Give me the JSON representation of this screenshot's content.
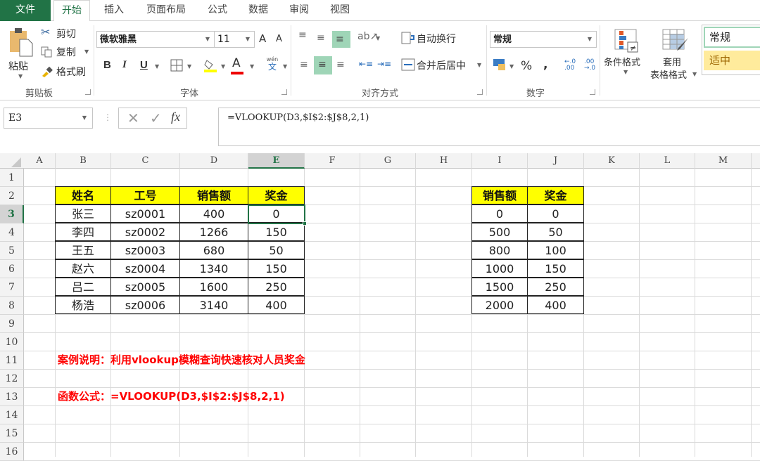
{
  "tabs": [
    {
      "label": "文件",
      "name": "tab-file"
    },
    {
      "label": "开始",
      "name": "tab-home",
      "active": true
    },
    {
      "label": "插入",
      "name": "tab-insert"
    },
    {
      "label": "页面布局",
      "name": "tab-page-layout"
    },
    {
      "label": "公式",
      "name": "tab-formulas"
    },
    {
      "label": "数据",
      "name": "tab-data"
    },
    {
      "label": "审阅",
      "name": "tab-review"
    },
    {
      "label": "视图",
      "name": "tab-view"
    }
  ],
  "ribbon": {
    "clipboard": {
      "label": "剪贴板",
      "paste": "粘贴",
      "cut": "剪切",
      "copy": "复制",
      "format_painter": "格式刷"
    },
    "font": {
      "label": "字体",
      "font_name": "微软雅黑",
      "font_size": "11",
      "bold": "B",
      "italic": "I",
      "underline": "U",
      "grow": "A",
      "shrink": "A",
      "font_color": "A",
      "phonetic_top": "wén",
      "phonetic_bottom": "文"
    },
    "alignment": {
      "label": "对齐方式",
      "wrap_text": "自动换行",
      "merge_center": "合并后居中"
    },
    "number": {
      "label": "数字",
      "format": "常规",
      "percent": "%",
      "comma": ",",
      "inc_decimal": "←.0 .00",
      "dec_decimal": ".00 →.0"
    },
    "styles": {
      "conditional_formatting": "条件格式",
      "format_as_table_1": "套用",
      "format_as_table_2": "表格格式",
      "style_normal": "常规",
      "style_neutral": "适中"
    }
  },
  "formula_bar": {
    "name_box": "E3",
    "cancel_icon": "✕",
    "enter_icon": "✓",
    "fx": "fx",
    "formula": "=VLOOKUP(D3,$I$2:$J$8,2,1)"
  },
  "columns": [
    "A",
    "B",
    "C",
    "D",
    "E",
    "F",
    "G",
    "H",
    "I",
    "J",
    "K",
    "L",
    "M"
  ],
  "selected_column": "E",
  "rows": [
    "1",
    "2",
    "3",
    "4",
    "5",
    "6",
    "7",
    "8",
    "9",
    "10",
    "11",
    "12",
    "13",
    "14",
    "15",
    "16"
  ],
  "selected_row": "3",
  "main_table": {
    "headers": [
      "姓名",
      "工号",
      "销售额",
      "奖金"
    ],
    "rows": [
      [
        "张三",
        "sz0001",
        "400",
        "0"
      ],
      [
        "李四",
        "sz0002",
        "1266",
        "150"
      ],
      [
        "王五",
        "sz0003",
        "680",
        "50"
      ],
      [
        "赵六",
        "sz0004",
        "1340",
        "150"
      ],
      [
        "吕二",
        "sz0005",
        "1600",
        "250"
      ],
      [
        "杨浩",
        "sz0006",
        "3140",
        "400"
      ]
    ]
  },
  "lookup_table": {
    "headers": [
      "销售额",
      "奖金"
    ],
    "rows": [
      [
        "0",
        "0"
      ],
      [
        "500",
        "50"
      ],
      [
        "800",
        "100"
      ],
      [
        "1000",
        "150"
      ],
      [
        "1500",
        "250"
      ],
      [
        "2000",
        "400"
      ]
    ]
  },
  "notes": {
    "description": "案例说明：利用vlookup模糊查询快速核对人员奖金",
    "formula": "函数公式：=VLOOKUP(D3,$I$2:$J$8,2,1)"
  },
  "colors": {
    "excel_green": "#217346",
    "header_yellow": "#ffff00",
    "note_red": "#ff0000",
    "neutral_style": "#ffeb9c"
  }
}
